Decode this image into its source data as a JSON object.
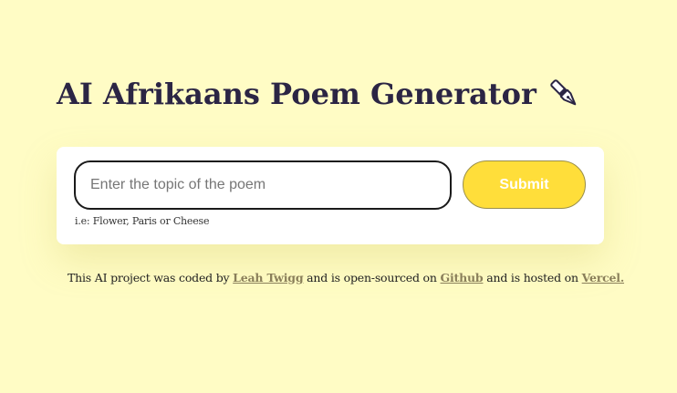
{
  "header": {
    "title": "AI Afrikaans Poem Generator",
    "title_icon": "fountain-pen-icon"
  },
  "form": {
    "topic_placeholder": "Enter the topic of the poem",
    "topic_value": "",
    "submit_label": "Submit",
    "hint": "i.e: Flower, Paris or Cheese"
  },
  "footer": {
    "text_1": "This AI project was coded by",
    "author_link": "Leah Twigg",
    "text_2": "and is open-sourced on",
    "github_link": "Github",
    "text_3": "and is hosted on",
    "vercel_link": "Vercel."
  },
  "colors": {
    "background": "#FFFCC5",
    "title": "#2b2544",
    "submit_bg": "#FFDE3A",
    "link": "#8a7f5a"
  }
}
